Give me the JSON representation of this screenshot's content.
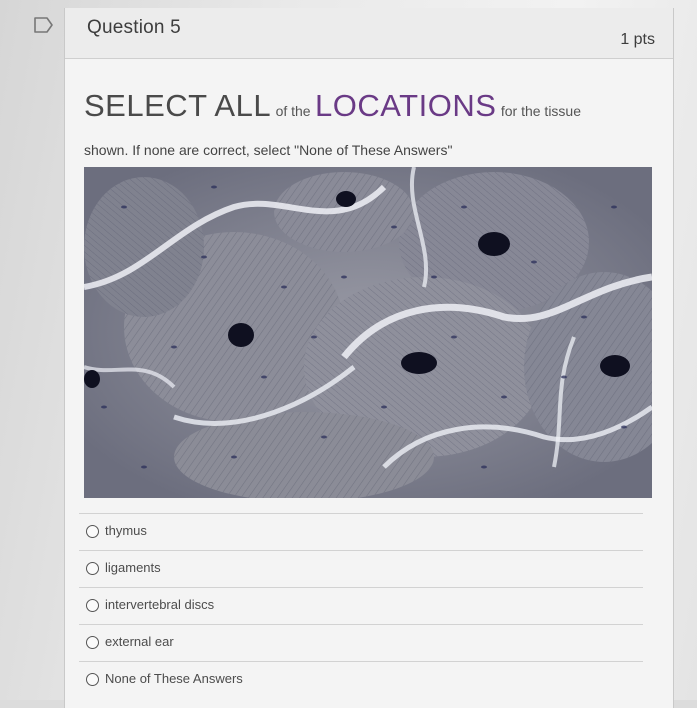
{
  "header": {
    "title": "Question 5",
    "points": "1 pts"
  },
  "prompt": {
    "part1": "SELECT ALL",
    "part2": "of the",
    "part3": "LOCATIONS",
    "part4": "for the tissue",
    "line2": "shown.  If none are correct, select \"None of These Answers\""
  },
  "options": [
    {
      "label": "thymus"
    },
    {
      "label": "ligaments"
    },
    {
      "label": "intervertebral discs"
    },
    {
      "label": "external ear"
    },
    {
      "label": "None of These Answers"
    }
  ],
  "colors": {
    "accent": "#6a3a86",
    "tissue_stain": "#4a4f7a"
  },
  "icons": {
    "flag": "bookmark-flag-icon",
    "radio": "radio-icon"
  }
}
